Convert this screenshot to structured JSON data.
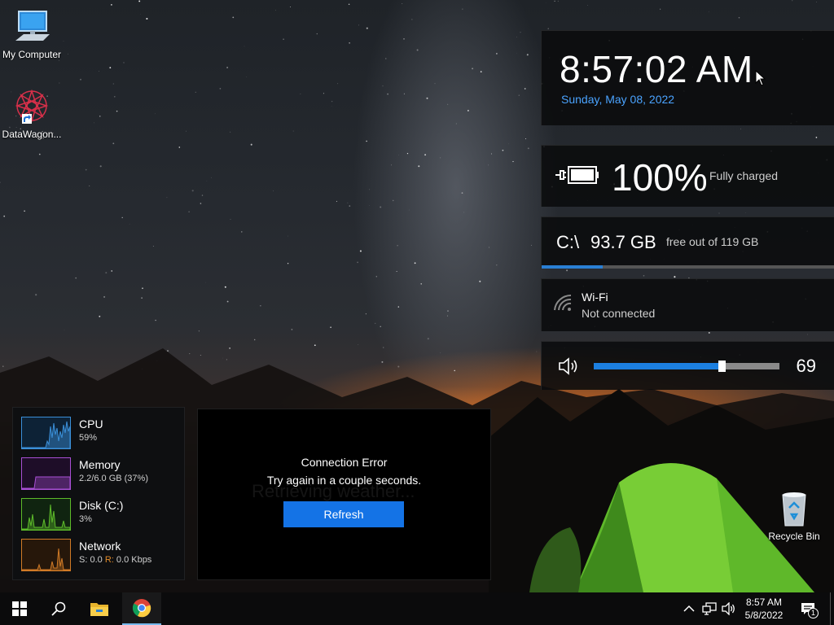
{
  "desktop": {
    "icons": [
      {
        "label": "My Computer",
        "icon": "computer-icon"
      },
      {
        "label": "DataWagon...",
        "icon": "datawagon-icon"
      },
      {
        "label": "Recycle Bin",
        "icon": "recycle-bin-icon"
      }
    ]
  },
  "widgets": {
    "clock": {
      "time": "8:57:02 AM",
      "date": "Sunday, May 08, 2022",
      "date_color": "#4aa3ff"
    },
    "battery": {
      "percent": "100%",
      "status": "Fully charged",
      "icon": "battery-plug-icon"
    },
    "disk": {
      "drive": "C:\\",
      "free": "93.7 GB",
      "of_total": "free out of 119 GB",
      "used_fraction": 0.21,
      "bar_color": "#2a7fd4"
    },
    "wifi": {
      "name": "Wi-Fi",
      "status": "Not connected",
      "icon": "wifi-icon"
    },
    "volume": {
      "value": "69",
      "level": 0.69,
      "icon": "speaker-icon",
      "bar_color": "#1c7fe0"
    },
    "perf": {
      "rows": [
        {
          "title": "CPU",
          "sub": "59%",
          "color": "#3a8fd8"
        },
        {
          "title": "Memory",
          "sub": "2.2/6.0 GB (37%)",
          "color": "#a84fd4"
        },
        {
          "title": "Disk (C:)",
          "sub": "3%",
          "color": "#5dbb2a"
        },
        {
          "title": "Network",
          "s_label": "S:",
          "s_value": "0.0",
          "r_label": "R:",
          "r_value": "0.0 Kbps",
          "color": "#d07a26"
        }
      ]
    },
    "weather": {
      "ghost_text": "Retrieving weather...",
      "error_title": "Connection Error",
      "error_message": "Try again in a couple seconds.",
      "refresh_label": "Refresh",
      "button_color": "#1473e6"
    }
  },
  "taskbar": {
    "pinned": [
      "start-icon",
      "search-icon",
      "file-explorer-icon",
      "chrome-icon"
    ],
    "tray": {
      "time": "8:57 AM",
      "date": "5/8/2022",
      "notification_count": "1",
      "icons": [
        "chevron-up-icon",
        "network-icon",
        "volume-icon",
        "notification-icon"
      ]
    }
  }
}
